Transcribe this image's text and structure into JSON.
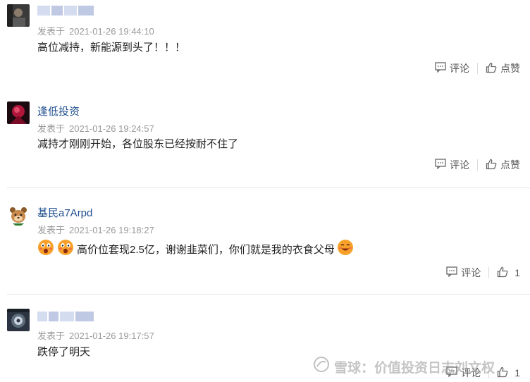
{
  "comments": [
    {
      "username": "",
      "published_label": "发表于",
      "time": "2021-01-26 19:44:10",
      "text": "高位减持，新能源到头了！！！",
      "reply_label": "评论",
      "like_label": "点赞"
    },
    {
      "username": "逢低投资",
      "published_label": "发表于",
      "time": "2021-01-26 19:24:57",
      "text": "减持才刚刚开始，各位股东已经按耐不住了",
      "reply_label": "评论",
      "like_label": "点赞"
    },
    {
      "username": "基民a7Arpd",
      "published_label": "发表于",
      "time": "2021-01-26 19:18:27",
      "text": "高价位套现2.5亿，谢谢韭菜们，你们就是我的衣食父母",
      "reply_label": "评论",
      "like_count": "1"
    },
    {
      "username": "",
      "published_label": "发表于",
      "time": "2021-01-26 19:17:57",
      "text": "跌停了明天",
      "reply_label": "评论",
      "like_count": "1"
    }
  ],
  "watermark": "雪球：价值投资日志刘文权",
  "icons": {
    "reply": "comment-icon",
    "like": "thumbs-up-icon",
    "emoji_shock": "shocked-face-emoji",
    "emoji_smile": "smile-face-emoji"
  },
  "colors": {
    "username": "#1f4f8f",
    "meta": "#999999",
    "divider": "#e6e6e6"
  }
}
